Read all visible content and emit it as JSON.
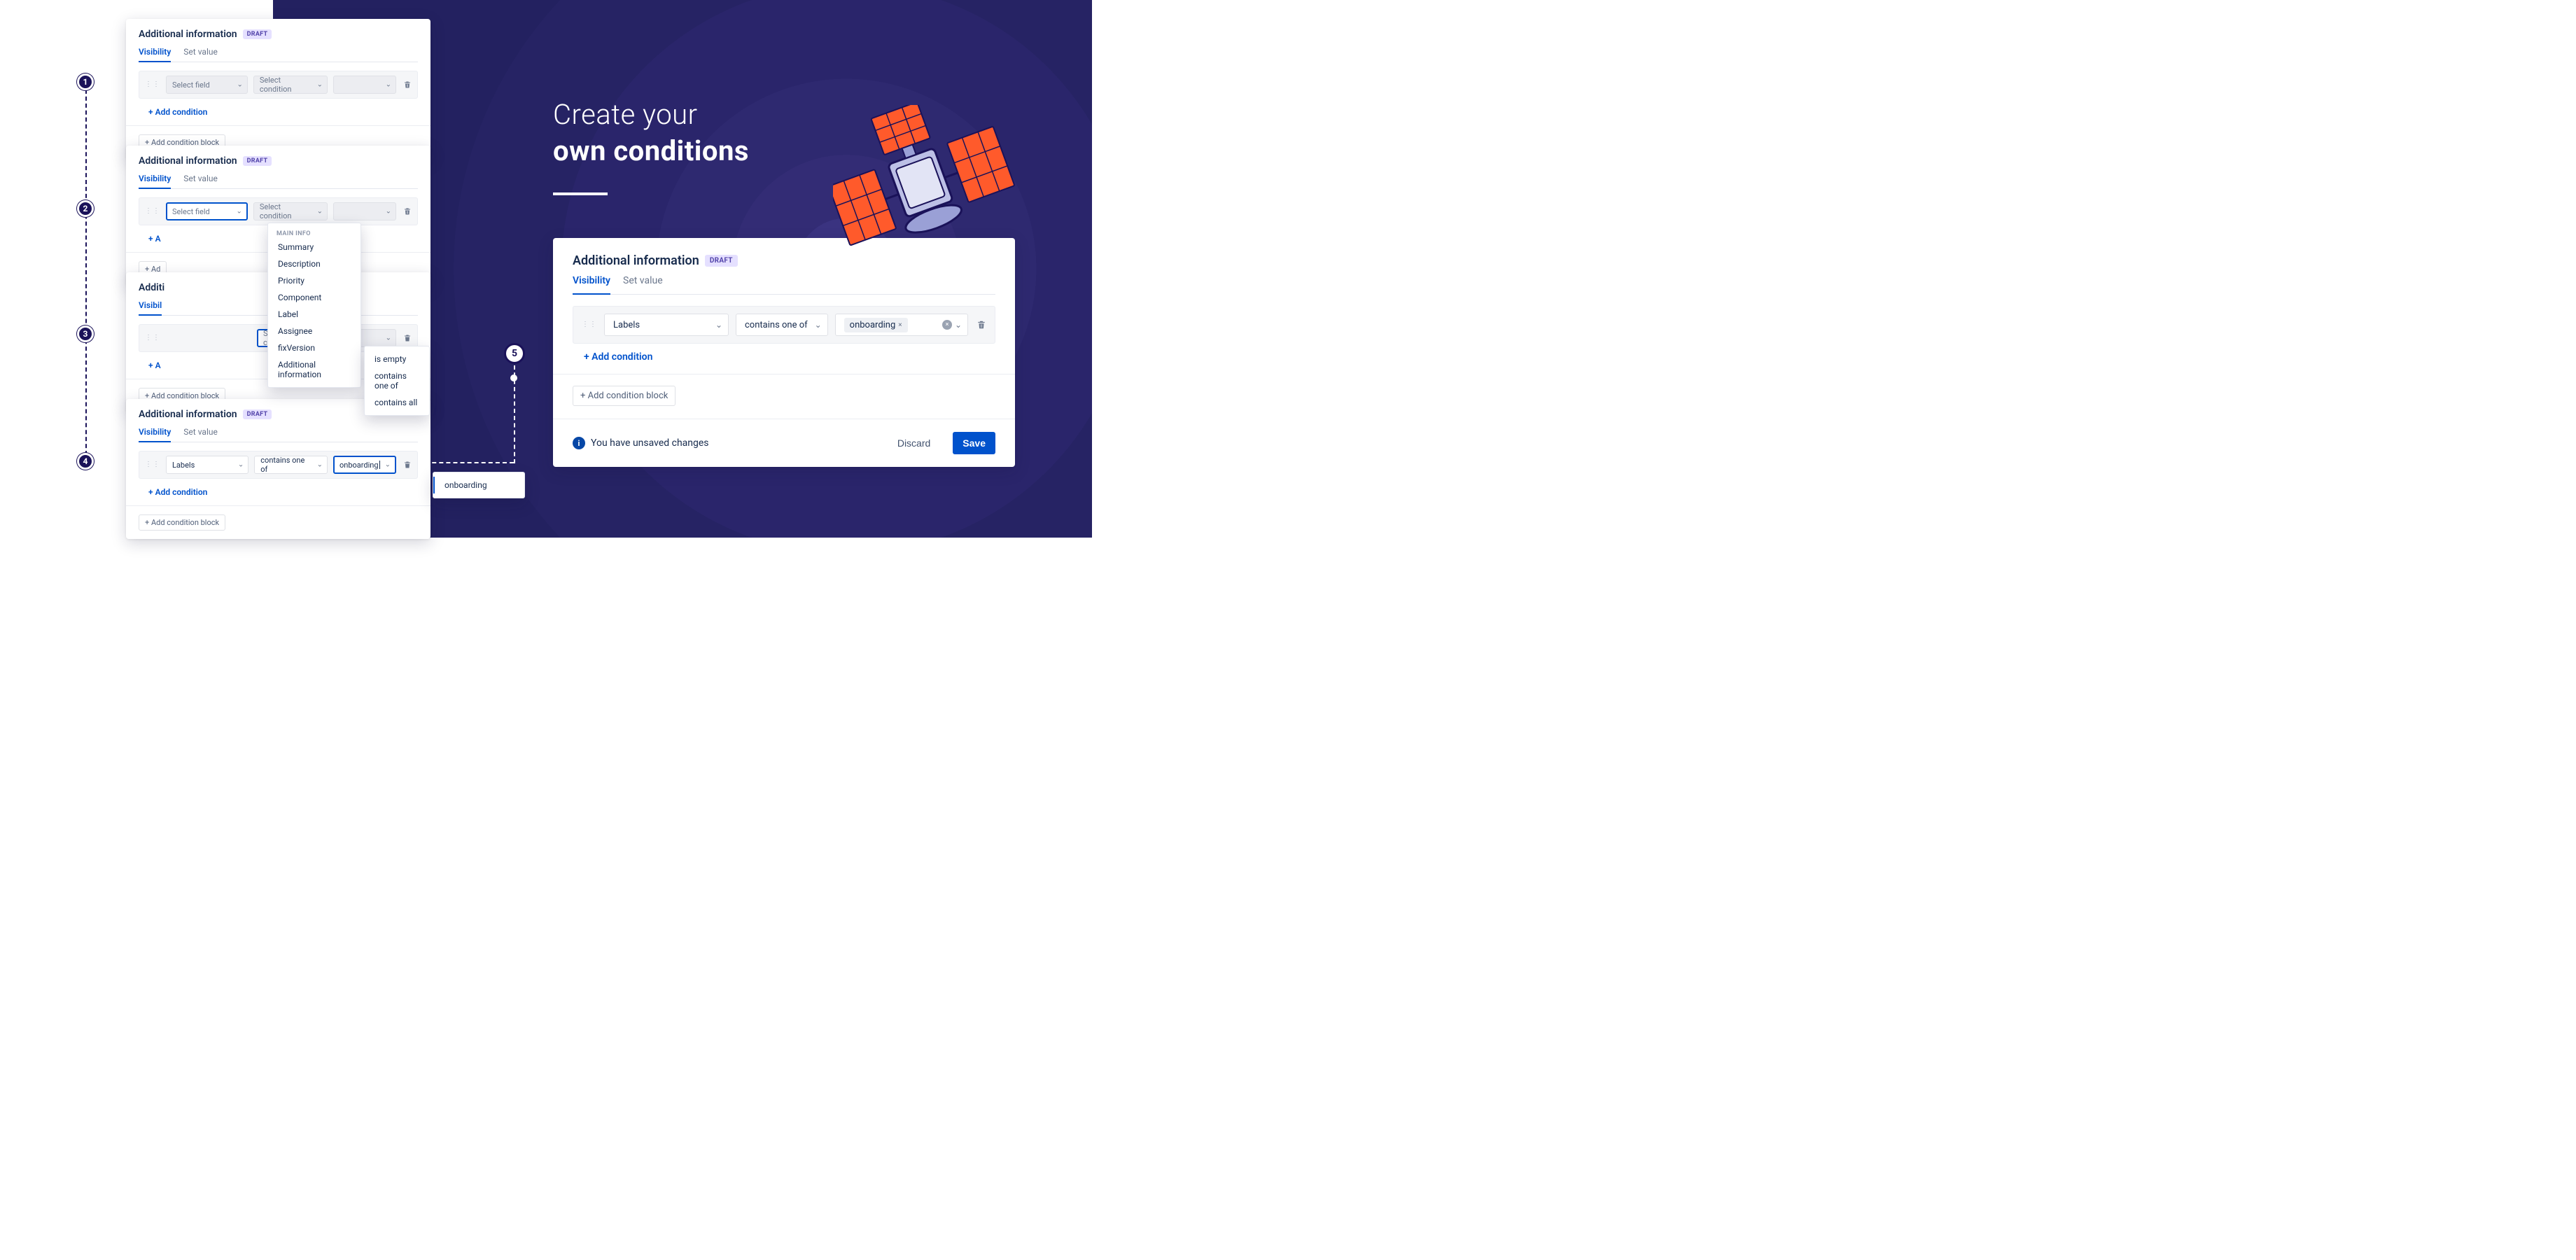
{
  "heading": {
    "line1": "Create your",
    "line2": "own conditions"
  },
  "steps": {
    "s1": "1",
    "s2": "2",
    "s3": "3",
    "s4": "4",
    "s5": "5"
  },
  "card_common": {
    "title": "Additional information",
    "draft": "DRAFT",
    "tab_visibility": "Visibility",
    "tab_setvalue": "Set value",
    "add_condition": "+ Add condition",
    "add_block": "+ Add condition block",
    "select_field_ph": "Select field",
    "select_cond_ph": "Select condition"
  },
  "field_dropdown": {
    "group": "MAIN INFO",
    "options": [
      "Summary",
      "Description",
      "Priority",
      "Component",
      "Label",
      "Assignee",
      "fixVersion",
      "Additional information"
    ]
  },
  "cond_dropdown": {
    "options": [
      "is empty",
      "contains one of",
      "contains all"
    ]
  },
  "step4": {
    "field": "Labels",
    "cond": "contains one of",
    "value_typed": "onboarding",
    "value_suggestion": "onboarding"
  },
  "big": {
    "field": "Labels",
    "cond": "contains one of",
    "chip": "onboarding",
    "footer_info": "You have unsaved changes",
    "discard": "Discard",
    "save": "Save"
  }
}
